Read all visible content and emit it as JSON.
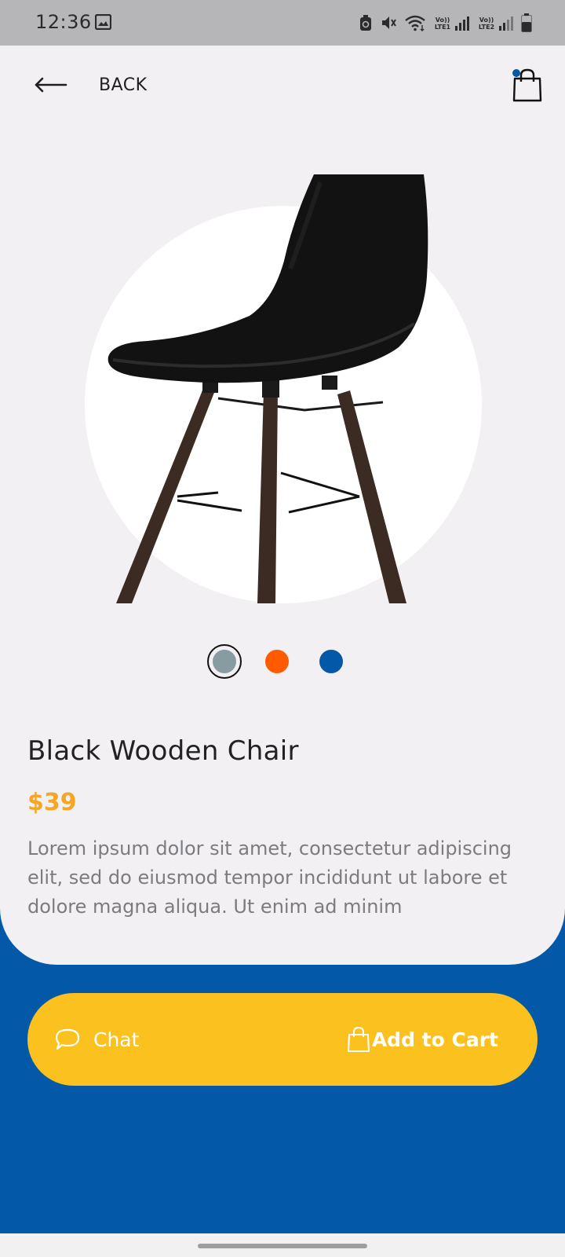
{
  "status_bar": {
    "time": "12:36",
    "icons": [
      "image-icon",
      "alarm-icon",
      "mute-icon",
      "wifi-icon",
      "signal-lte1-icon",
      "signal-lte2-icon",
      "battery-icon"
    ],
    "sim1_tag": "Vo)) LTE1",
    "sim2_tag": "Vo)) LTE2"
  },
  "header": {
    "back_label": "BACK",
    "cart_badge": true
  },
  "product": {
    "name": "Black Wooden Chair",
    "price": "$39",
    "description": "Lorem ipsum dolor sit amet, consectetur adipiscing elit, sed do eiusmod tempor incididunt ut labore et dolore magna aliqua. Ut enim ad minim",
    "colors": [
      {
        "name": "gray",
        "hex": "#879ba0",
        "selected": true
      },
      {
        "name": "orange",
        "hex": "#ff5a00",
        "selected": false
      },
      {
        "name": "blue",
        "hex": "#0359a8",
        "selected": false
      }
    ]
  },
  "actions": {
    "chat_label": "Chat",
    "add_to_cart_label": "Add to Cart"
  },
  "theme": {
    "accent_blue": "#0359a8",
    "accent_yellow": "#fbc11e",
    "price_color": "#f5a623",
    "background": "#f2f0f3"
  }
}
